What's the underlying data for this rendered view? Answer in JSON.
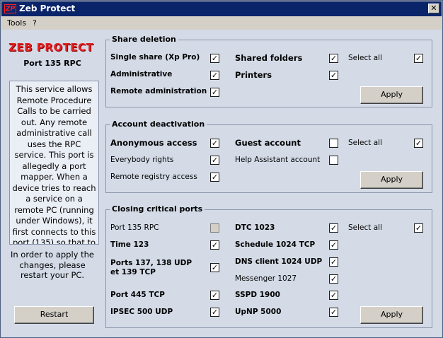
{
  "window": {
    "title": "Zeb Protect",
    "icon_text": "ZP",
    "close_glyph": "✕"
  },
  "menu": {
    "items": [
      "Tools",
      "?"
    ]
  },
  "sidebar": {
    "logo_text": "ZEB PROTECT",
    "title": "Port 135 RPC",
    "description": "This service allows Remote Procedure Calls to be carried out. Any remote administrative call uses the RPC service. This port is allegedly a port mapper. When a device tries to reach a service on a remote PC (running under Windows), it first connects to this port (135) so that to locate the real port we want to reach.",
    "note": "In order to apply the changes, please restart your PC.",
    "restart_label": "Restart"
  },
  "share_deletion": {
    "legend": "Share deletion",
    "items": [
      {
        "label": "Single share (Xp Pro)",
        "checked": true
      },
      {
        "label": "Administrative",
        "checked": true
      },
      {
        "label": "Remote administration",
        "checked": true
      },
      {
        "label": "Shared folders",
        "checked": true
      },
      {
        "label": "Printers",
        "checked": true
      }
    ],
    "select_all": {
      "label": "Select all",
      "checked": true
    },
    "apply_label": "Apply"
  },
  "account_deactivation": {
    "legend": "Account deactivation",
    "items": [
      {
        "label": "Anonymous access",
        "checked": true
      },
      {
        "label": "Everybody rights",
        "checked": true
      },
      {
        "label": "Remote registry access",
        "checked": true
      },
      {
        "label": "Guest account",
        "checked": false
      },
      {
        "label": "Help Assistant account",
        "checked": false
      }
    ],
    "select_all": {
      "label": "Select all",
      "checked": true
    },
    "apply_label": "Apply"
  },
  "closing_ports": {
    "legend": "Closing critical ports",
    "items": [
      {
        "label": "Port 135 RPC",
        "checked": false,
        "disabled": true
      },
      {
        "label": "Time 123",
        "checked": true
      },
      {
        "label": "Ports 137, 138 UDP et 139 TCP",
        "checked": true
      },
      {
        "label": "Port 445 TCP",
        "checked": true
      },
      {
        "label": "IPSEC 500 UDP",
        "checked": true
      },
      {
        "label": "DTC 1023",
        "checked": true
      },
      {
        "label": "Schedule 1024 TCP",
        "checked": true
      },
      {
        "label": "DNS client 1024 UDP",
        "checked": true
      },
      {
        "label": "Messenger 1027",
        "checked": true
      },
      {
        "label": "SSPD 1900",
        "checked": true
      },
      {
        "label": "UpNP 5000",
        "checked": true
      }
    ],
    "select_all": {
      "label": "Select all",
      "checked": true
    },
    "apply_label": "Apply"
  },
  "check_glyph": "✓"
}
